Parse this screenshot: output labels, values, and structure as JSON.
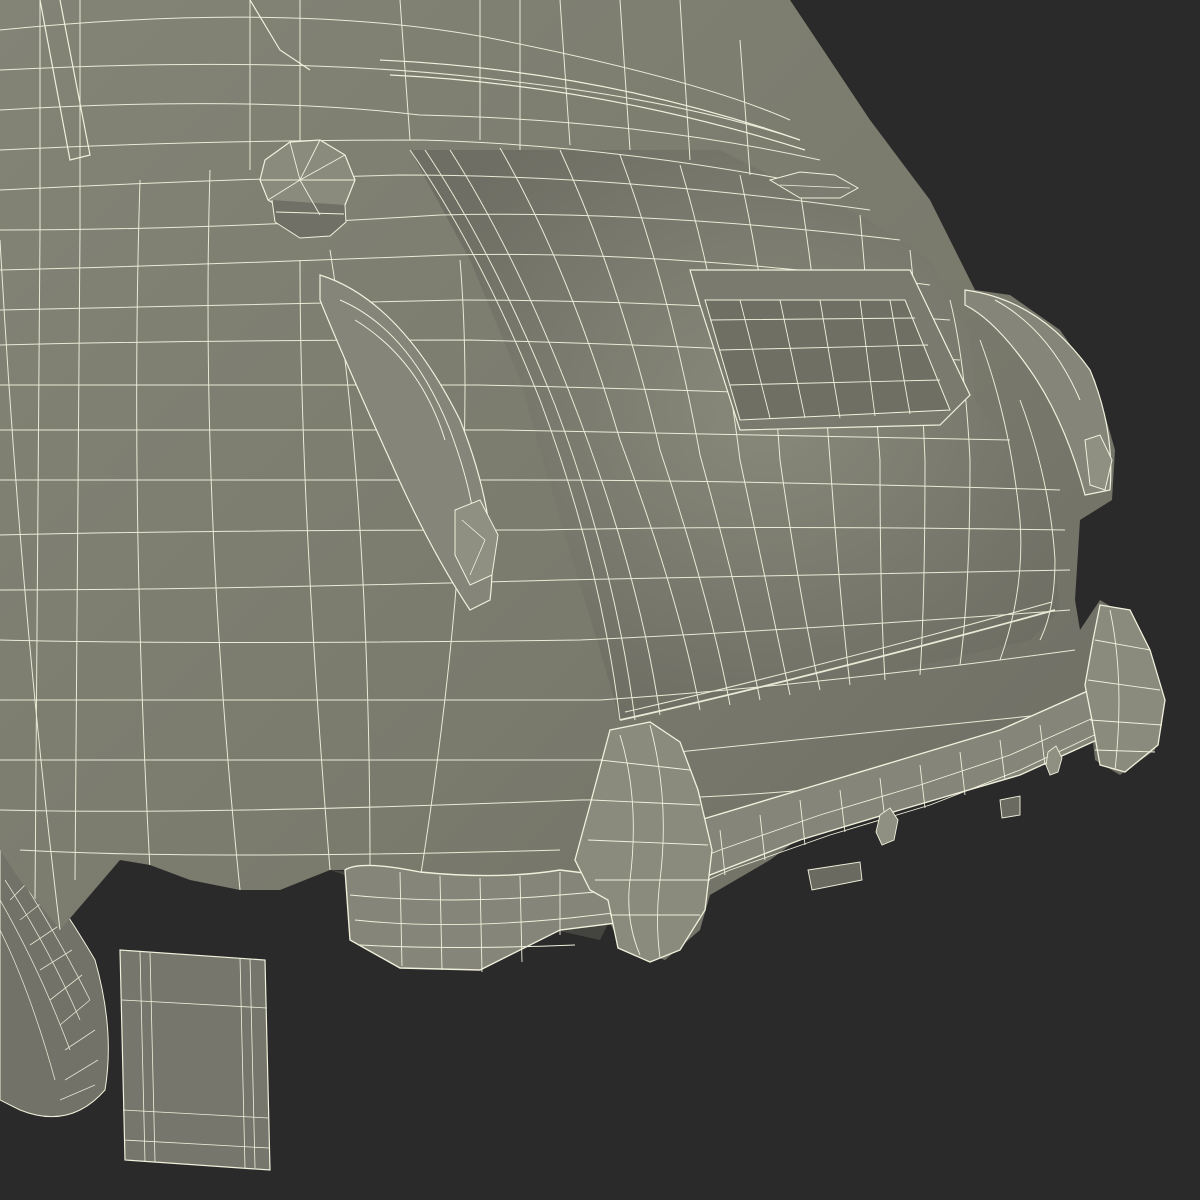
{
  "scene": {
    "subject": "car-rear-wireframe",
    "colors": {
      "background": "#2a2a2a",
      "body_fill": "#7a7a6e",
      "body_light": "#878778",
      "body_shadow": "#5f5f55",
      "wire": "#f0f0dc",
      "tire": "#6f6f66",
      "mudflap": "#76766c"
    }
  }
}
